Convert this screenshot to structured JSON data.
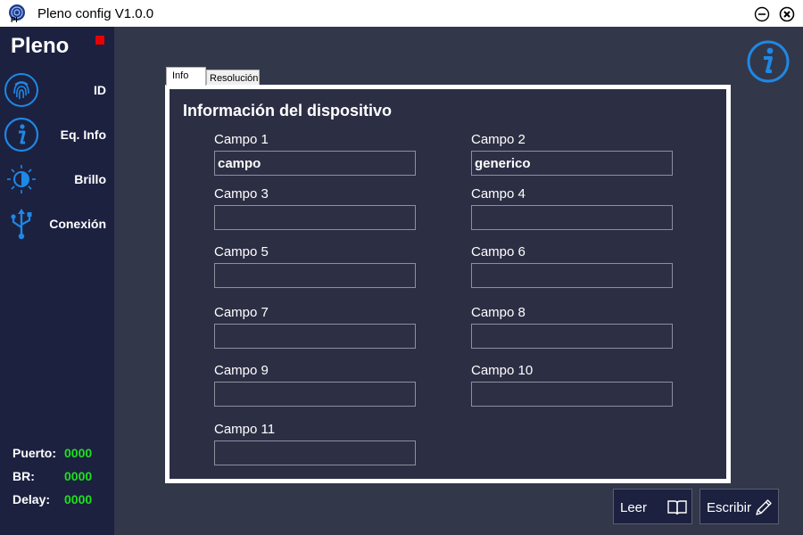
{
  "window": {
    "title": "Pleno config V1.0.0"
  },
  "sidebar": {
    "brand": "Pleno",
    "items": [
      {
        "label": "ID",
        "icon": "fingerprint-icon"
      },
      {
        "label": "Eq. Info",
        "icon": "info-icon"
      },
      {
        "label": "Brillo",
        "icon": "brightness-icon"
      },
      {
        "label": "Conexión",
        "icon": "usb-icon"
      }
    ],
    "stats": [
      {
        "label": "Puerto:",
        "value": "0000"
      },
      {
        "label": "BR:",
        "value": "0000"
      },
      {
        "label": "Delay:",
        "value": "0000"
      }
    ],
    "status_color": "#e80000"
  },
  "tabs": [
    {
      "label": "Info",
      "active": true
    },
    {
      "label": "Resolución",
      "active": false
    }
  ],
  "panel": {
    "title": "Información del dispositivo",
    "fields": [
      {
        "label": "Campo 1",
        "value": "campo"
      },
      {
        "label": "Campo 2",
        "value": "generico"
      },
      {
        "label": "Campo 3",
        "value": ""
      },
      {
        "label": "Campo 4",
        "value": ""
      },
      {
        "label": "Campo 5",
        "value": ""
      },
      {
        "label": "Campo 6",
        "value": ""
      },
      {
        "label": "Campo 7",
        "value": ""
      },
      {
        "label": "Campo 8",
        "value": ""
      },
      {
        "label": "Campo 9",
        "value": ""
      },
      {
        "label": "Campo 10",
        "value": ""
      },
      {
        "label": "Campo 11",
        "value": ""
      }
    ]
  },
  "actions": {
    "read_label": "Leer",
    "write_label": "Escribir"
  },
  "colors": {
    "accent": "#1e88e5",
    "sidebar_bg": "#1c2140",
    "main_bg": "#33374a",
    "stat_value": "#1fe01f"
  }
}
